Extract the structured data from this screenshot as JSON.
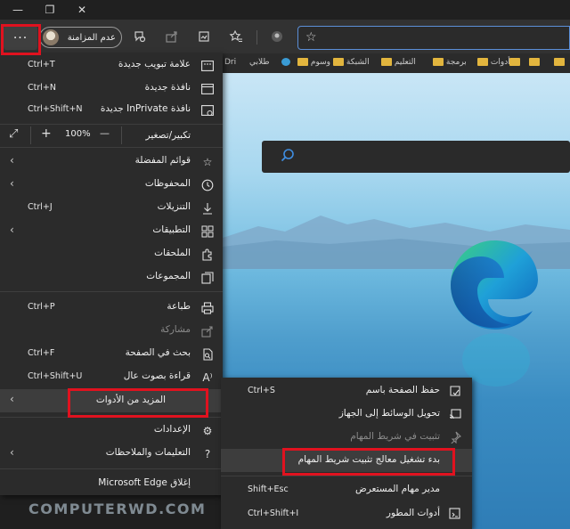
{
  "window": {
    "minimize": "—",
    "restore": "❐",
    "close": "✕"
  },
  "toolbar": {
    "more_label": "···",
    "profile_label": "عدم المزامنة"
  },
  "favorites_bar": {
    "items": [
      "Dri",
      "طلابي",
      "وسوم",
      "الشبكة",
      "التعليم",
      "برمجة",
      "أدوات"
    ]
  },
  "menu": {
    "items": [
      {
        "label": "علامة تبويب جديدة",
        "shortcut": "Ctrl+T"
      },
      {
        "label": "نافذة جديدة",
        "shortcut": "Ctrl+N"
      },
      {
        "label": "نافذة InPrivate جديدة",
        "shortcut": "Ctrl+Shift+N"
      },
      {
        "label": "قوائم المفضلة",
        "shortcut": ""
      },
      {
        "label": "المحفوظات",
        "shortcut": ""
      },
      {
        "label": "التنزيلات",
        "shortcut": "Ctrl+J"
      },
      {
        "label": "التطبيقات",
        "shortcut": ""
      },
      {
        "label": "الملحقات",
        "shortcut": ""
      },
      {
        "label": "المجموعات",
        "shortcut": ""
      },
      {
        "label": "طباعة",
        "shortcut": "Ctrl+P"
      },
      {
        "label": "مشاركة",
        "shortcut": ""
      },
      {
        "label": "بحث في الصفحة",
        "shortcut": "Ctrl+F"
      },
      {
        "label": "قراءة بصوت عال",
        "shortcut": "Ctrl+Shift+U"
      },
      {
        "label": "المزيد من الأدوات",
        "shortcut": ""
      },
      {
        "label": "الإعدادات",
        "shortcut": ""
      },
      {
        "label": "التعليمات والملاحظات",
        "shortcut": ""
      },
      {
        "label": "إغلاق Microsoft Edge",
        "shortcut": ""
      }
    ],
    "zoom": {
      "label": "تكبير/تصغير",
      "value": "100%",
      "plus": "+",
      "minus": "—"
    }
  },
  "submenu": {
    "items": [
      {
        "label": "حفظ الصفحة باسم",
        "shortcut": "Ctrl+S"
      },
      {
        "label": "تحويل الوسائط إلى الجهاز",
        "shortcut": ""
      },
      {
        "label": "تثبيت في شريط المهام",
        "shortcut": ""
      },
      {
        "label": "بدء تشغيل معالج تثبيت شريط المهام",
        "shortcut": ""
      },
      {
        "label": "مدير مهام المستعرض",
        "shortcut": "Shift+Esc"
      },
      {
        "label": "أدوات المطور",
        "shortcut": "Ctrl+Shift+I"
      }
    ]
  },
  "watermark": "COMPUTERWD.COM",
  "colors": {
    "highlight_box": "#e0121f",
    "menu_bg": "#2b2b2b",
    "address_border": "#5b8fd8"
  }
}
